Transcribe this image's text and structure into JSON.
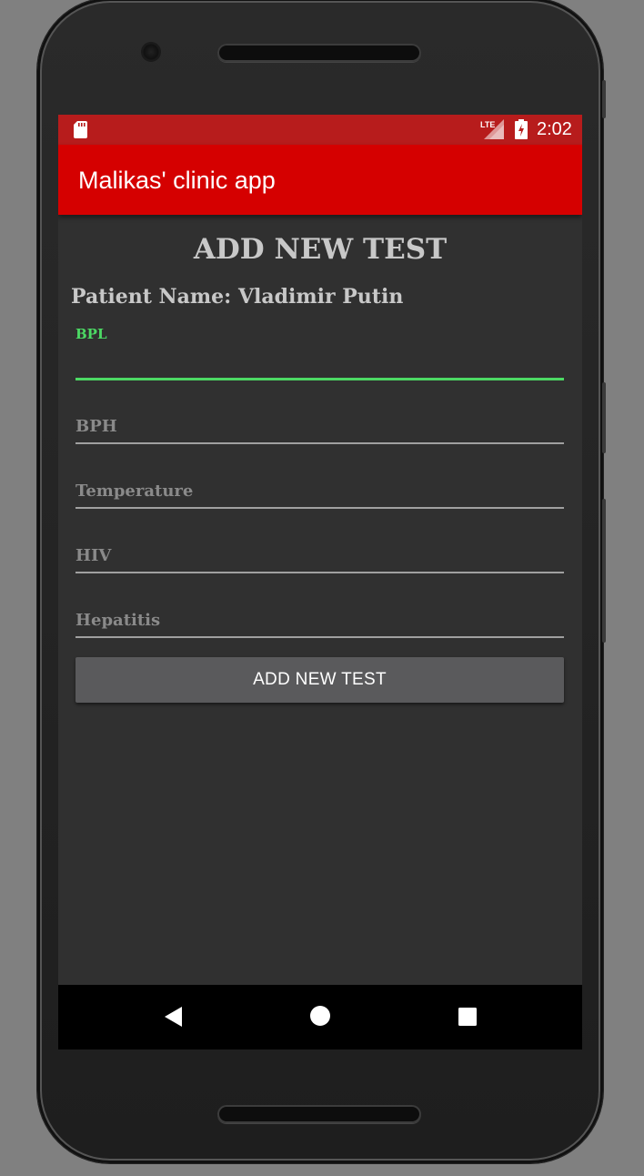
{
  "status_bar": {
    "time": "2:02",
    "network_label": "LTE",
    "icons": [
      "sd-card-icon",
      "lte-signal-icon",
      "battery-charging-icon"
    ]
  },
  "app_bar": {
    "title": "Malikas' clinic app"
  },
  "form": {
    "heading": "ADD NEW TEST",
    "patient_label": "Patient Name: Vladimir Putin",
    "fields": [
      {
        "label": "BPL",
        "value": "",
        "focused": true
      },
      {
        "placeholder": "BPH",
        "value": ""
      },
      {
        "placeholder": "Temperature",
        "value": ""
      },
      {
        "placeholder": "HIV",
        "value": ""
      },
      {
        "placeholder": "Hepatitis",
        "value": ""
      }
    ],
    "submit_label": "ADD NEW TEST"
  },
  "nav_bar": {
    "icons": [
      "back-icon",
      "home-icon",
      "recents-icon"
    ]
  },
  "colors": {
    "status_bar": "#b71c1c",
    "app_bar": "#d50000",
    "background": "#303030",
    "accent": "#4cd964",
    "button": "#5a5a5c"
  }
}
